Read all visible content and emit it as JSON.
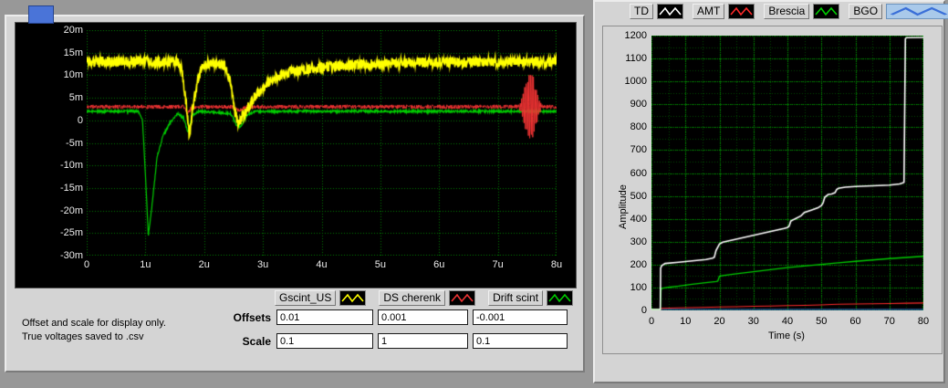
{
  "window": {
    "bg": "#989898",
    "panel_bg": "#d4d4d4",
    "accent_blue": "#4a74d8"
  },
  "left_panel": {
    "offsets_label": "Offsets",
    "scale_label": "Scale",
    "offsets": [
      "0.01",
      "0.001",
      "-0.001"
    ],
    "scales": [
      "0.1",
      "1",
      "0.1"
    ],
    "note_line1": "Offset and scale for display only.",
    "note_line2": "True voltages saved to .csv",
    "legend": [
      {
        "label": "Gscint_US",
        "color": "#ffff00"
      },
      {
        "label": "DS cherenk",
        "color": "#ee3333"
      },
      {
        "label": "Drift scint",
        "color": "#00cc00"
      }
    ]
  },
  "right_panel": {
    "legend": [
      {
        "label": "TD",
        "color": "#ffffff",
        "selected": false
      },
      {
        "label": "AMT",
        "color": "#ff2a2a",
        "selected": false
      },
      {
        "label": "Brescia",
        "color": "#00cc00",
        "selected": false
      },
      {
        "label": "BGO",
        "color": "#3a6fd8",
        "selected": true
      }
    ]
  },
  "chart_data": [
    {
      "type": "line",
      "name": "waveform-graph",
      "bg": "#000000",
      "grid_color": "#007a00",
      "ylim_mV": [
        -30,
        20
      ],
      "xlim_us": [
        0,
        8
      ],
      "yticks": [
        "20m",
        "15m",
        "10m",
        "5m",
        "0",
        "-5m",
        "-10m",
        "-15m",
        "-20m",
        "-25m",
        "-30m"
      ],
      "xticks": [
        "0",
        "1u",
        "2u",
        "3u",
        "4u",
        "5u",
        "6u",
        "7u",
        "8u"
      ],
      "series": [
        {
          "name": "Drift scint",
          "color": "#00cc00",
          "noise": 0.25,
          "width": 1.2,
          "keypoints": [
            [
              0,
              2
            ],
            [
              0.88,
              2
            ],
            [
              0.95,
              0
            ],
            [
              1.0,
              -12
            ],
            [
              1.05,
              -25.5
            ],
            [
              1.12,
              -18
            ],
            [
              1.2,
              -8
            ],
            [
              1.3,
              -3.5
            ],
            [
              1.42,
              -0.5
            ],
            [
              1.55,
              1.5
            ],
            [
              1.65,
              0.5
            ],
            [
              1.72,
              -2.5
            ],
            [
              1.8,
              1
            ],
            [
              1.9,
              2
            ],
            [
              2.45,
              1.5
            ],
            [
              2.55,
              -1
            ],
            [
              2.62,
              -1.5
            ],
            [
              2.72,
              1
            ],
            [
              2.85,
              2
            ],
            [
              8,
              2
            ]
          ]
        },
        {
          "name": "DS cherenk",
          "color": "#ee3333",
          "noise": 0.45,
          "width": 1.0,
          "keypoints": [
            [
              0,
              3
            ],
            [
              1.65,
              3
            ],
            [
              1.72,
              1.5
            ],
            [
              1.8,
              3
            ],
            [
              2.5,
              3
            ],
            [
              2.6,
              2
            ],
            [
              2.7,
              3
            ],
            [
              7.3,
              3
            ],
            [
              7.9,
              3
            ],
            [
              8,
              3
            ]
          ],
          "burst": {
            "center": 7.55,
            "halfwidth": 0.22,
            "amp": 7.5,
            "freq": 40
          }
        },
        {
          "name": "Gscint_US",
          "color": "#ffff00",
          "noise": 1.15,
          "width": 1.6,
          "keypoints": [
            [
              0,
              13
            ],
            [
              1.55,
              13
            ],
            [
              1.62,
              11
            ],
            [
              1.7,
              3
            ],
            [
              1.75,
              -4
            ],
            [
              1.8,
              2
            ],
            [
              1.88,
              8
            ],
            [
              1.95,
              11.5
            ],
            [
              2.05,
              12.5
            ],
            [
              2.35,
              12.3
            ],
            [
              2.45,
              8
            ],
            [
              2.52,
              2
            ],
            [
              2.58,
              -0.5
            ],
            [
              2.65,
              0.5
            ],
            [
              2.75,
              3
            ],
            [
              2.9,
              6
            ],
            [
              3.1,
              8.5
            ],
            [
              3.4,
              10.5
            ],
            [
              3.8,
              11.5
            ],
            [
              4.5,
              12.3
            ],
            [
              5.5,
              12.8
            ],
            [
              8,
              13
            ]
          ]
        }
      ]
    },
    {
      "type": "line",
      "name": "amplitude-chart",
      "bg": "#000000",
      "xlabel": "Time (s)",
      "ylabel": "Amplitude",
      "xlim": [
        0,
        80
      ],
      "ylim": [
        0,
        1200
      ],
      "xticks": [
        0,
        10,
        20,
        30,
        40,
        50,
        60,
        70,
        80
      ],
      "yticks": [
        0,
        100,
        200,
        300,
        400,
        500,
        600,
        700,
        800,
        900,
        1000,
        1100,
        1200
      ],
      "series": [
        {
          "name": "BGO",
          "color": "#3a6fd8",
          "width": 1.0,
          "points": [
            [
              0,
              0
            ],
            [
              80,
              0
            ]
          ]
        },
        {
          "name": "AMT",
          "color": "#ff2a2a",
          "width": 1.2,
          "points": [
            [
              0,
              0
            ],
            [
              2.6,
              0
            ],
            [
              3,
              9
            ],
            [
              8,
              11
            ],
            [
              15,
              13
            ],
            [
              20,
              15
            ],
            [
              25,
              16
            ],
            [
              30,
              18
            ],
            [
              35,
              19
            ],
            [
              40,
              21
            ],
            [
              45,
              22
            ],
            [
              50,
              24
            ],
            [
              53,
              26
            ],
            [
              55,
              27
            ],
            [
              60,
              28
            ],
            [
              65,
              29
            ],
            [
              70,
              30
            ],
            [
              75,
              31
            ],
            [
              80,
              32
            ]
          ]
        },
        {
          "name": "Brescia",
          "color": "#00cc00",
          "width": 1.4,
          "points": [
            [
              0,
              0
            ],
            [
              2.6,
              0
            ],
            [
              2.8,
              90
            ],
            [
              3,
              96
            ],
            [
              5,
              101
            ],
            [
              8,
              106
            ],
            [
              12,
              114
            ],
            [
              16,
              121
            ],
            [
              19,
              126
            ],
            [
              19.5,
              128
            ],
            [
              20,
              149
            ],
            [
              21,
              152
            ],
            [
              25,
              160
            ],
            [
              30,
              169
            ],
            [
              35,
              178
            ],
            [
              40,
              187
            ],
            [
              45,
              194
            ],
            [
              50,
              201
            ],
            [
              55,
              208
            ],
            [
              60,
              214
            ],
            [
              65,
              220
            ],
            [
              70,
              226
            ],
            [
              75,
              231
            ],
            [
              80,
              236
            ]
          ]
        },
        {
          "name": "TD",
          "color": "#ffffff",
          "width": 1.6,
          "points": [
            [
              0,
              0
            ],
            [
              2.6,
              0
            ],
            [
              2.7,
              185
            ],
            [
              3,
              195
            ],
            [
              4,
              205
            ],
            [
              8,
              210
            ],
            [
              12,
              216
            ],
            [
              16,
              222
            ],
            [
              18,
              228
            ],
            [
              18.5,
              232
            ],
            [
              19,
              262
            ],
            [
              20,
              290
            ],
            [
              21,
              298
            ],
            [
              24,
              308
            ],
            [
              27,
              318
            ],
            [
              30,
              328
            ],
            [
              33,
              338
            ],
            [
              36,
              348
            ],
            [
              39,
              358
            ],
            [
              40,
              362
            ],
            [
              40.5,
              368
            ],
            [
              41,
              390
            ],
            [
              42,
              398
            ],
            [
              44,
              413
            ],
            [
              45,
              428
            ],
            [
              47,
              438
            ],
            [
              49,
              448
            ],
            [
              50,
              458
            ],
            [
              50.5,
              470
            ],
            [
              51,
              494
            ],
            [
              52,
              506
            ],
            [
              53,
              508
            ],
            [
              54,
              514
            ],
            [
              54.5,
              528
            ],
            [
              55,
              533
            ],
            [
              57,
              538
            ],
            [
              60,
              541
            ],
            [
              65,
              544
            ],
            [
              70,
              547
            ],
            [
              73,
              552
            ],
            [
              74,
              557
            ],
            [
              74.3,
              560
            ],
            [
              74.7,
              1186
            ],
            [
              75,
              1191
            ],
            [
              80,
              1192
            ]
          ]
        }
      ]
    }
  ]
}
